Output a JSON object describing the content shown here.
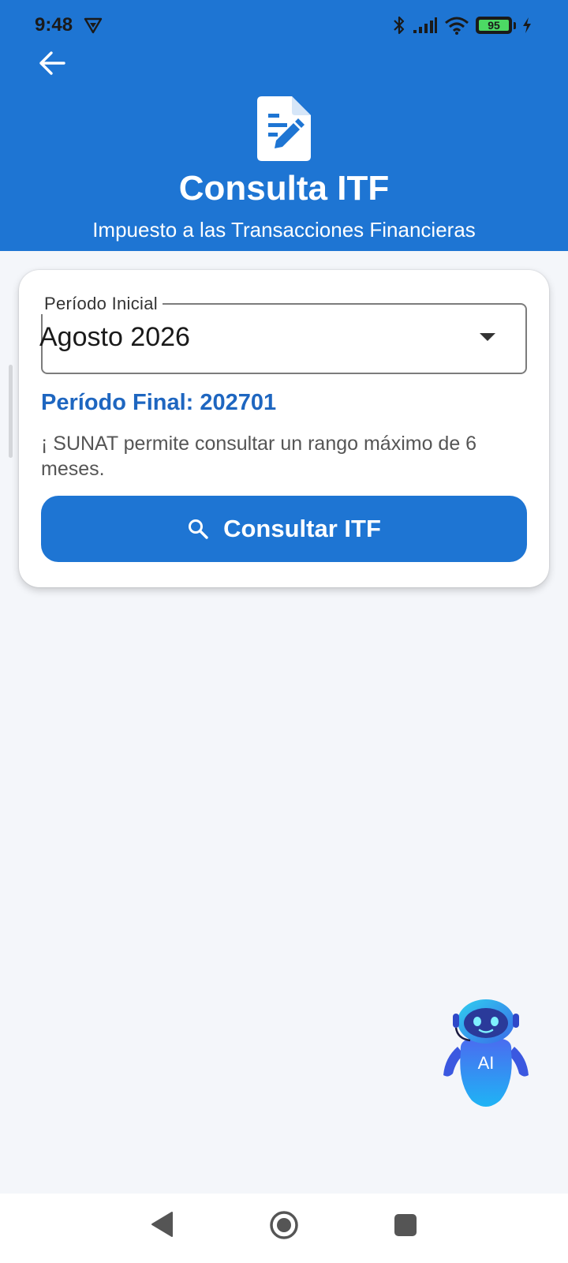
{
  "status_bar": {
    "time": "9:48",
    "battery": "95"
  },
  "header": {
    "title": "Consulta ITF",
    "subtitle": "Impuesto a las Transacciones Financieras"
  },
  "form": {
    "period_label": "Período Inicial",
    "period_value": "Agosto 2026",
    "period_final": "Período Final: 202701",
    "info": "¡ SUNAT permite consultar un rango máximo de 6 meses.",
    "button_label": "Consultar ITF"
  },
  "assistant": {
    "label": "AI"
  },
  "colors": {
    "primary": "#1e75d3",
    "background": "#f4f6fa",
    "accent_text": "#1e66c0"
  },
  "icons": [
    "back-arrow-icon",
    "document-edit-icon",
    "search-icon",
    "dropdown-arrow-icon",
    "ai-robot-icon",
    "bluetooth-icon",
    "signal-icon",
    "wifi-icon",
    "battery-icon",
    "charging-icon",
    "vpn-icon"
  ]
}
